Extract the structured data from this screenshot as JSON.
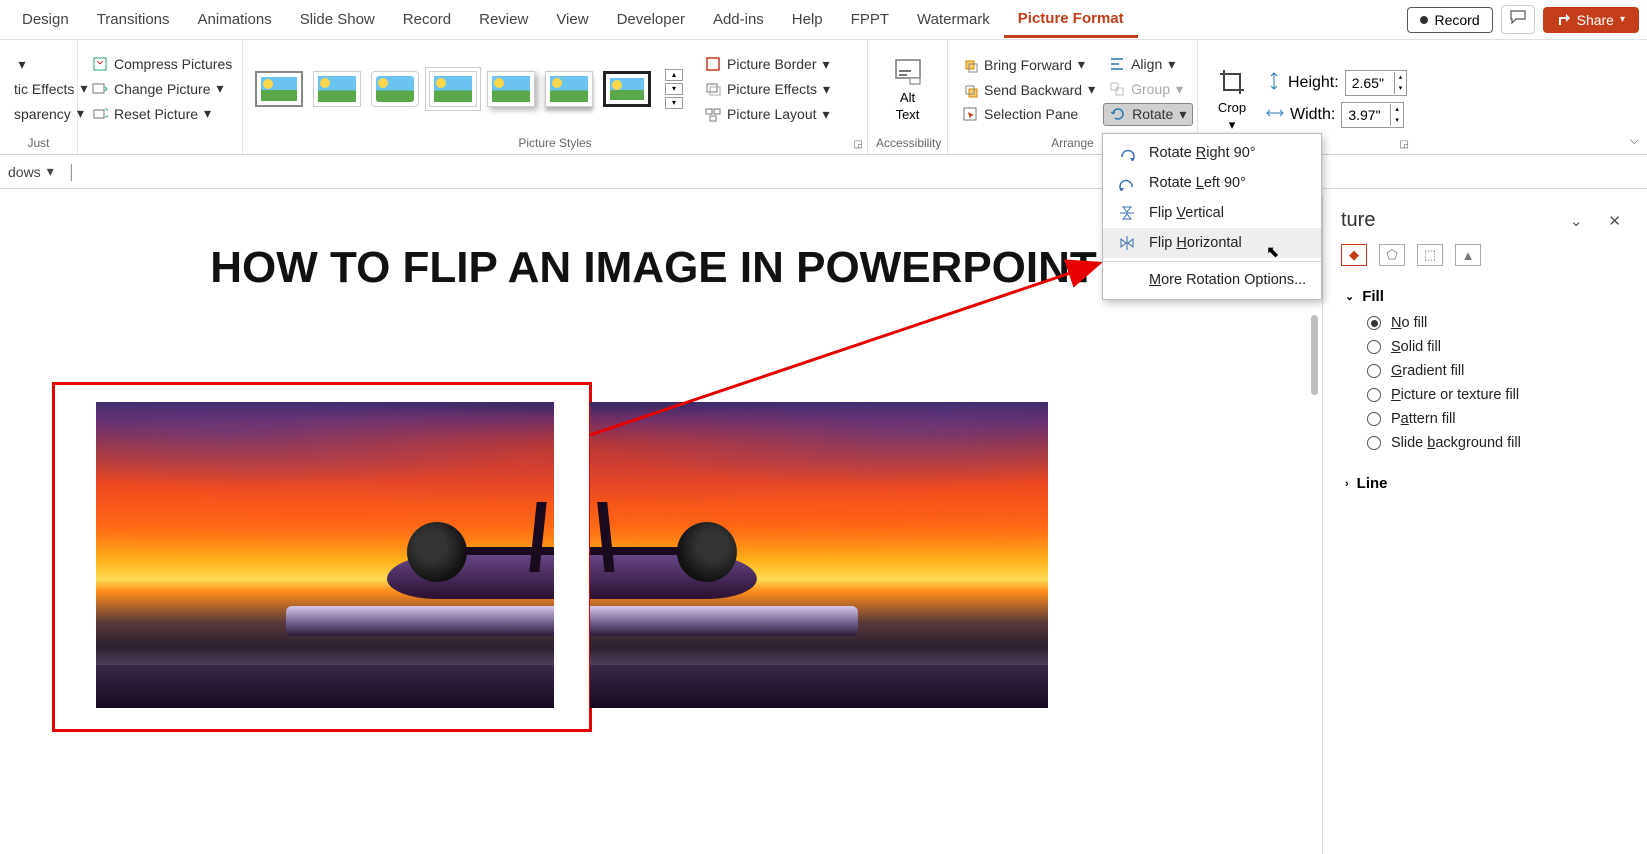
{
  "tabs": {
    "items": [
      "Design",
      "Transitions",
      "Animations",
      "Slide Show",
      "Record",
      "Review",
      "View",
      "Developer",
      "Add-ins",
      "Help",
      "FPPT",
      "Watermark",
      "Picture Format"
    ],
    "active": "Picture Format",
    "record_btn": "Record",
    "share_btn": "Share"
  },
  "ribbon": {
    "adjust": {
      "effects": "tic Effects",
      "transparency": "sparency",
      "compress": "Compress Pictures",
      "change": "Change Picture",
      "reset": "Reset Picture",
      "group_label": "Just"
    },
    "picture_styles": {
      "border": "Picture Border",
      "effects": "Picture Effects",
      "layout": "Picture Layout",
      "group_label": "Picture Styles"
    },
    "accessibility": {
      "alt_text_l1": "Alt",
      "alt_text_l2": "Text",
      "group_label": "Accessibility"
    },
    "arrange": {
      "bring_forward": "Bring Forward",
      "send_backward": "Send Backward",
      "selection_pane": "Selection Pane",
      "align": "Align",
      "group": "Group",
      "rotate": "Rotate",
      "group_label": "Arrange"
    },
    "size": {
      "crop": "Crop",
      "height_label": "Height:",
      "height_value": "2.65\"",
      "width_label": "Width:",
      "width_value": "3.97\""
    }
  },
  "subrow": {
    "dows": "dows"
  },
  "rotate_menu": {
    "right90": "Rotate Right 90°",
    "left90": "Rotate Left 90°",
    "flipv": "Flip Vertical",
    "fliph": "Flip Horizontal",
    "more": "More Rotation Options...",
    "underlines": {
      "right90": "R",
      "left90": "L",
      "flipv": "V",
      "fliph": "H",
      "more": "M"
    }
  },
  "slide": {
    "title": "HOW TO FLIP AN IMAGE IN POWERPOINT"
  },
  "format_pane": {
    "title_fragment": "ture",
    "fill_section": "Fill",
    "line_section": "Line",
    "options": {
      "no_fill": "No fill",
      "solid": "Solid fill",
      "gradient": "Gradient fill",
      "picture": "Picture or texture fill",
      "pattern": "Pattern fill",
      "slide_bg": "Slide background fill"
    },
    "underlines": {
      "no_fill": "N",
      "solid": "S",
      "gradient": "G",
      "picture": "P",
      "pattern": "A",
      "slide_bg": "b"
    },
    "selected": "no_fill"
  }
}
